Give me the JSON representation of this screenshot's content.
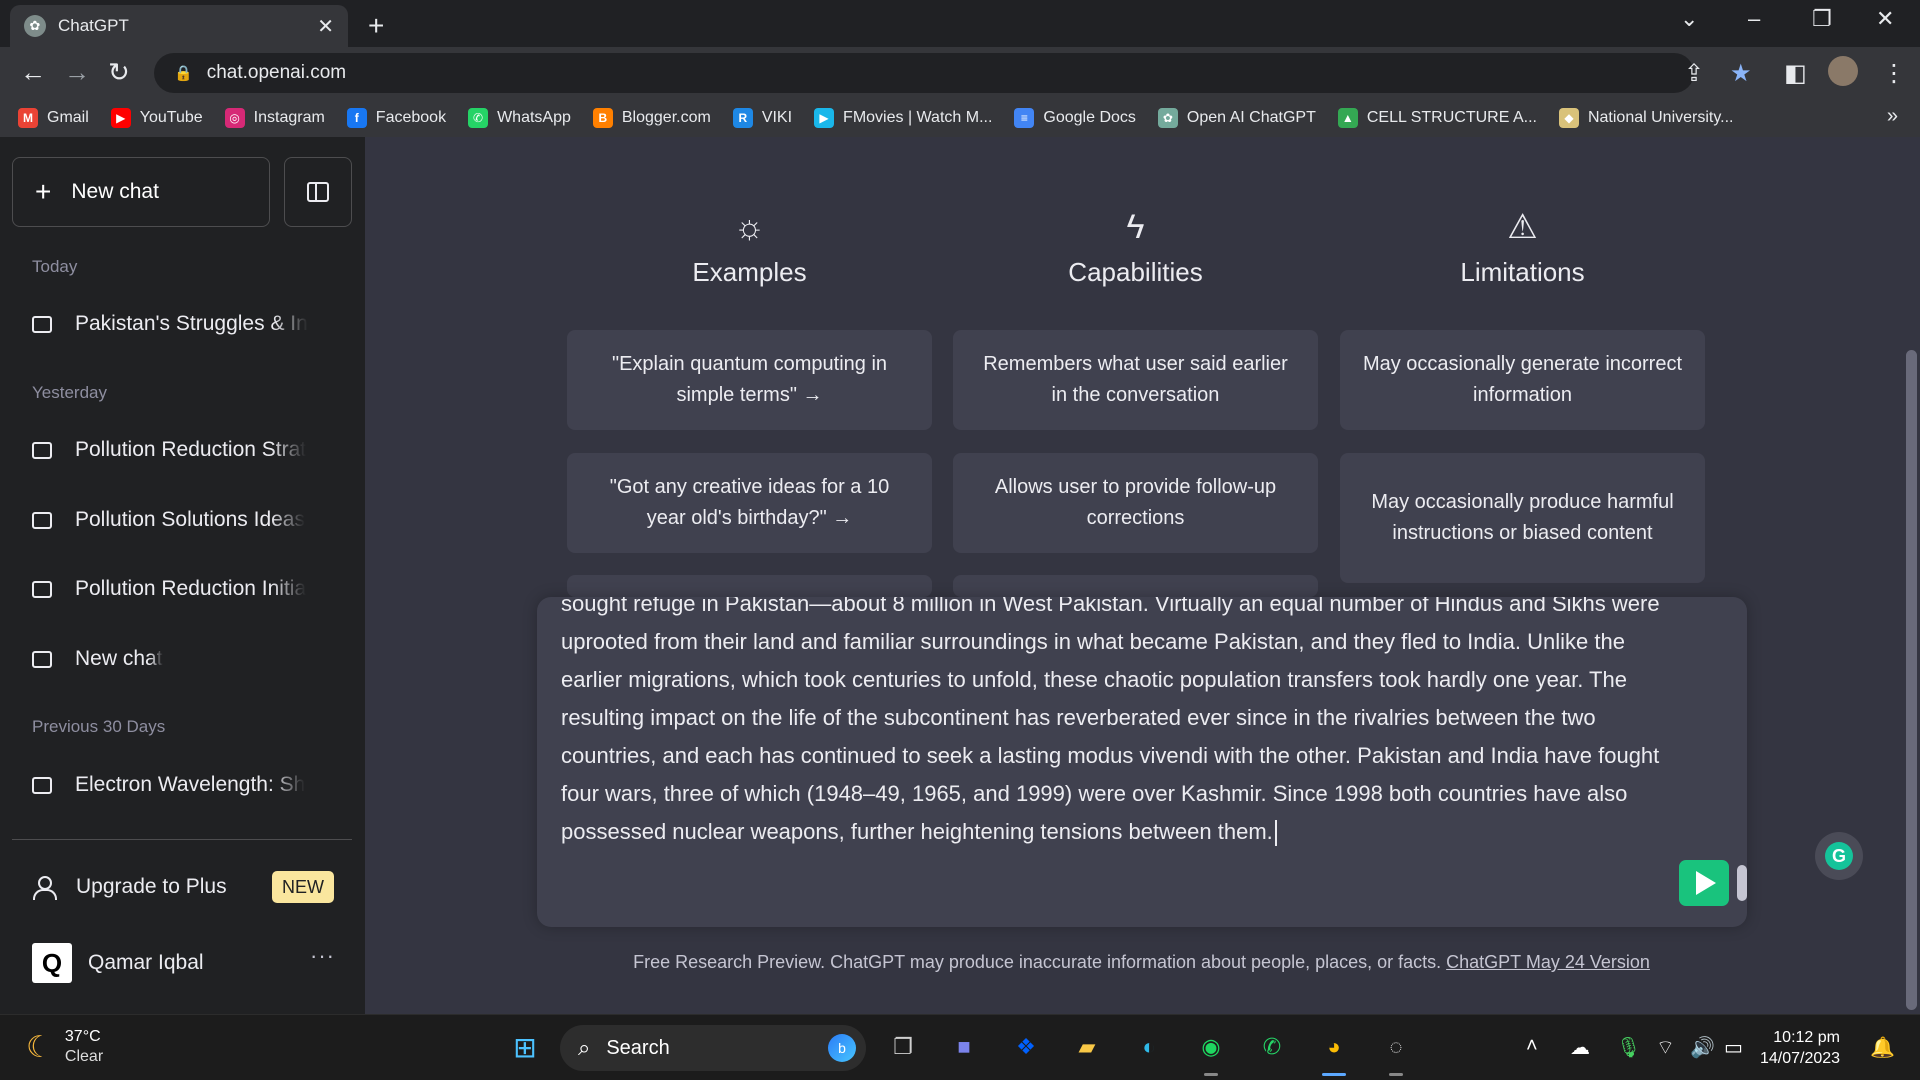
{
  "browser": {
    "tab_title": "ChatGPT",
    "tab_close": "✕",
    "new_tab": "+",
    "url": "chat.openai.com",
    "bookmarks": [
      {
        "label": "Gmail",
        "color": "#ea4335",
        "glyph": "M"
      },
      {
        "label": "YouTube",
        "color": "#ff0000",
        "glyph": "▶"
      },
      {
        "label": "Instagram",
        "color": "#d62976",
        "glyph": "◎"
      },
      {
        "label": "Facebook",
        "color": "#1877f2",
        "glyph": "f"
      },
      {
        "label": "WhatsApp",
        "color": "#25d366",
        "glyph": "✆"
      },
      {
        "label": "Blogger.com",
        "color": "#ff8000",
        "glyph": "B"
      },
      {
        "label": "VIKI",
        "color": "#1e88e5",
        "glyph": "R"
      },
      {
        "label": "FMovies | Watch M...",
        "color": "#1ab7ea",
        "glyph": "▶"
      },
      {
        "label": "Google Docs",
        "color": "#4285f4",
        "glyph": "≡"
      },
      {
        "label": "Open AI ChatGPT",
        "color": "#74aa9c",
        "glyph": "✿"
      },
      {
        "label": "CELL STRUCTURE A...",
        "color": "#34a853",
        "glyph": "▲"
      },
      {
        "label": "National University...",
        "color": "#d9c27a",
        "glyph": "◆"
      }
    ],
    "bookmarks_more": "»"
  },
  "sidebar": {
    "new_chat_label": "New chat",
    "sections": {
      "today": "Today",
      "yesterday": "Yesterday",
      "previous": "Previous 30 Days"
    },
    "conversations": [
      "Pakistan's Struggles & In",
      "Pollution Reduction Strat",
      "Pollution Solutions Ideas",
      "Pollution Reduction Initia",
      "New chat",
      "Electron Wavelength: Sh"
    ],
    "upgrade_label": "Upgrade to Plus",
    "new_badge": "NEW",
    "user_initial": "Q",
    "user_name": "Qamar Iqbal",
    "more": "···"
  },
  "main": {
    "columns": [
      {
        "icon": "sun-icon",
        "glyph": "☼",
        "title": "Examples",
        "cards": [
          "\"Explain quantum computing in simple terms\" →",
          "\"Got any creative ideas for a 10 year old's birthday?\" →"
        ]
      },
      {
        "icon": "lightning-icon",
        "glyph": "ϟ",
        "title": "Capabilities",
        "cards": [
          "Remembers what user said earlier in the conversation",
          "Allows user to provide follow-up corrections"
        ]
      },
      {
        "icon": "warning-icon",
        "glyph": "⚠",
        "title": "Limitations",
        "cards": [
          "May occasionally generate incorrect information",
          "May occasionally produce harmful instructions or biased content"
        ]
      }
    ],
    "composer_text": "sought refuge in Pakistan—about 8 million in West Pakistan. Virtually an equal number of Hindus and Sikhs were uprooted from their land and familiar surroundings in what became Pakistan, and they fled to India. Unlike the earlier migrations, which took centuries to unfold, these chaotic population transfers took hardly one year. The resulting impact on the life of the subcontinent has reverberated ever since in the rivalries between the two countries, and each has continued to seek a lasting modus vivendi with the other. Pakistan and India have fought four wars, three of which (1948–49, 1965, and 1999) were over Kashmir. Since 1998 both countries have also possessed nuclear weapons, further heightening tensions between them.",
    "footer_text": "Free Research Preview. ChatGPT may produce inaccurate information about people, places, or facts. ",
    "footer_link": "ChatGPT May 24 Version",
    "grammarly_glyph": "G"
  },
  "taskbar": {
    "temperature": "37°C",
    "condition": "Clear",
    "search_label": "Search",
    "bing_glyph": "b",
    "time": "10:12 pm",
    "date": "14/07/2023"
  },
  "colors": {
    "accent_send": "#19c37d",
    "badge": "#fae69e",
    "sidebar_bg": "#202123",
    "main_bg": "#343541",
    "card_bg": "#40414f"
  }
}
